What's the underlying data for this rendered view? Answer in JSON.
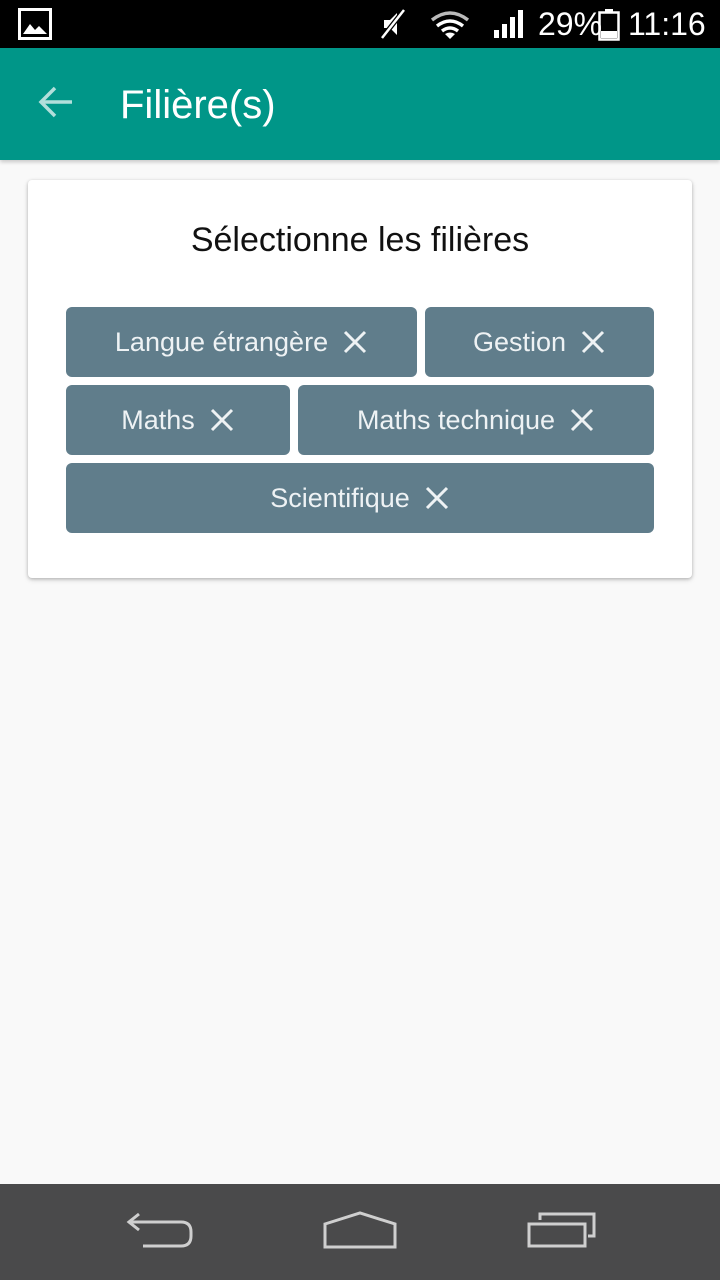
{
  "status_bar": {
    "battery_percent": "29%",
    "time": "11:16",
    "icons": [
      "gallery-icon",
      "mute-icon",
      "wifi-icon",
      "signal-icon",
      "battery-icon"
    ]
  },
  "app_bar": {
    "title": "Filière(s)",
    "back_icon": "arrow-back-icon",
    "background": "#009688"
  },
  "card": {
    "heading": "Sélectionne les filières",
    "chips": [
      {
        "label": "Langue étrangère"
      },
      {
        "label": "Gestion"
      },
      {
        "label": "Maths"
      },
      {
        "label": "Maths technique"
      },
      {
        "label": "Scientifique"
      }
    ],
    "chip_color": "#607d8b"
  },
  "nav_bar": {
    "icons": [
      "back-nav-icon",
      "home-nav-icon",
      "recents-nav-icon"
    ]
  }
}
